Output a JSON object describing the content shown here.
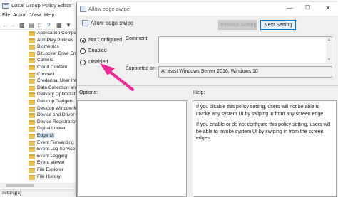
{
  "gpe": {
    "title": "Local Group Policy Editor",
    "menu": [
      "File",
      "Action",
      "View",
      "Help"
    ],
    "tree_items": [
      {
        "label": "Application Compat"
      },
      {
        "label": "AutoPlay Policies"
      },
      {
        "label": "Biometrics"
      },
      {
        "label": "BitLocker Drive Encr"
      },
      {
        "label": "Camera"
      },
      {
        "label": "Cloud Content"
      },
      {
        "label": "Connect"
      },
      {
        "label": "Credential User Inter"
      },
      {
        "label": "Data Collection and"
      },
      {
        "label": "Delivery Optimization"
      },
      {
        "label": "Desktop Gadgets"
      },
      {
        "label": "Desktop Window M"
      },
      {
        "label": "Device and Driver Co"
      },
      {
        "label": "Device Registration"
      },
      {
        "label": "Digital Locker"
      },
      {
        "label": "Edge UI",
        "selected": true
      },
      {
        "label": "Event Forwarding"
      },
      {
        "label": "Event Log Service"
      },
      {
        "label": "Event Logging"
      },
      {
        "label": "Event Viewer"
      },
      {
        "label": "File Explorer"
      },
      {
        "label": "File History"
      }
    ],
    "status": "setting(s)"
  },
  "dialog": {
    "title": "Allow edge swipe",
    "heading": "Allow edge swipe",
    "prev_button": "Previous Setting",
    "next_button": "Next Setting",
    "radios": {
      "not_configured": "Not Configured",
      "enabled": "Enabled",
      "disabled": "Disabled",
      "selected": "not_configured"
    },
    "comment_label": "Comment:",
    "supported_label": "Supported on:",
    "supported_value": "At least Windows Server 2016, Windows 10",
    "options_label": "Options:",
    "help_label": "Help:",
    "help_paragraphs": [
      "If you disable this policy setting, users will not be able to invoke any system UI by swiping in from any screen edge.",
      "If you enable or do not configure this policy setting, users will be able to invoke system UI by swiping in from the screen edges."
    ]
  },
  "colors": {
    "annotation_arrow": "#ee2a9a",
    "selection": "#cce4f7",
    "focus_border": "#0078d7"
  }
}
